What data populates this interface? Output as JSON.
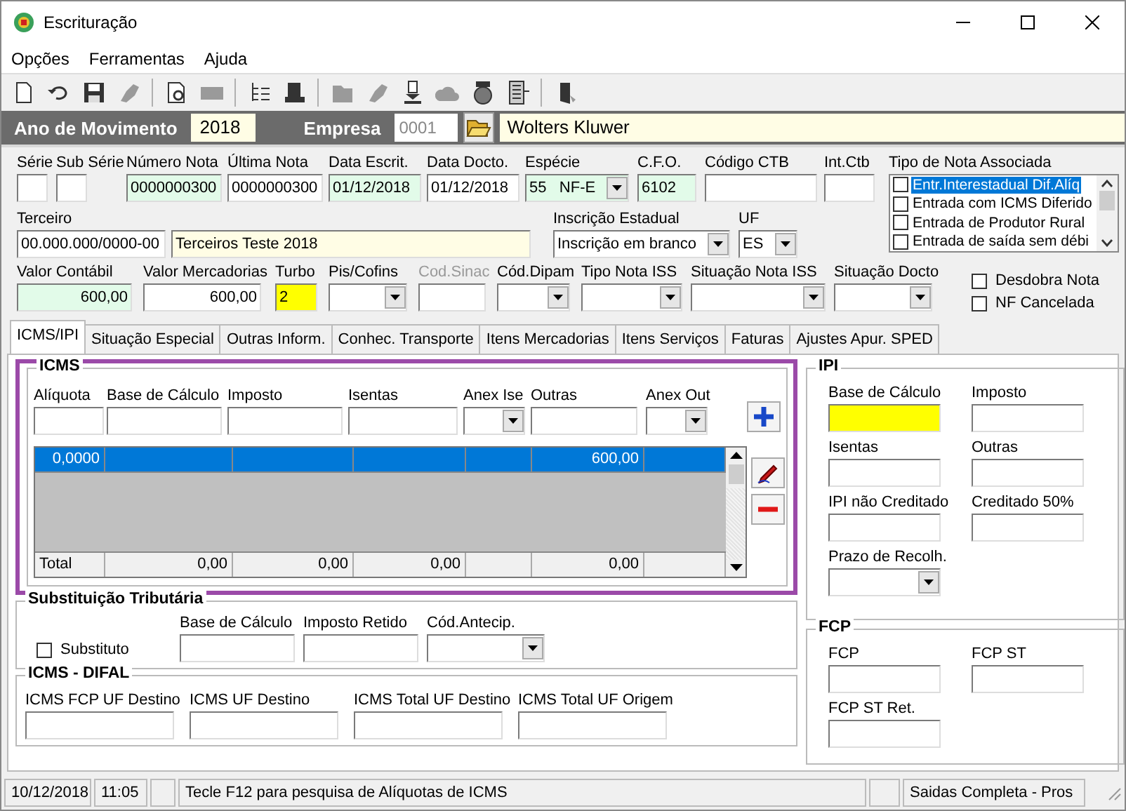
{
  "window": {
    "title": "Escrituração"
  },
  "menu": [
    {
      "label": "Opções"
    },
    {
      "label": "Ferramentas"
    },
    {
      "label": "Ajuda"
    }
  ],
  "toolbar": [
    {
      "kind": "page",
      "disabled": false
    },
    {
      "kind": "undo",
      "disabled": false
    },
    {
      "kind": "save",
      "disabled": false
    },
    {
      "kind": "brush",
      "disabled": true
    },
    {
      "kind": "sep"
    },
    {
      "kind": "preview",
      "disabled": false
    },
    {
      "kind": "nfe",
      "disabled": true
    },
    {
      "kind": "sep"
    },
    {
      "kind": "tree",
      "disabled": false
    },
    {
      "kind": "stamp",
      "disabled": false
    },
    {
      "kind": "sep"
    },
    {
      "kind": "folder",
      "disabled": true
    },
    {
      "kind": "brush",
      "disabled": true
    },
    {
      "kind": "download",
      "disabled": false
    },
    {
      "kind": "cloud",
      "disabled": true
    },
    {
      "kind": "coin",
      "disabled": false
    },
    {
      "kind": "list",
      "disabled": false
    },
    {
      "kind": "sep"
    },
    {
      "kind": "exit",
      "disabled": false
    }
  ],
  "header": {
    "year_label": "Ano de Movimento",
    "year": "2018",
    "company_label": "Empresa",
    "company_code": "0001",
    "company_name": "Wolters Kluwer"
  },
  "document_fields": [
    {
      "label": "Série",
      "kind": "text",
      "color": "#ffffff"
    },
    {
      "label": "Sub Série",
      "kind": "text",
      "color": "#ffffff"
    },
    {
      "label": "Número Nota",
      "value": "0000000300",
      "kind": "text",
      "color": "#e2fbe9"
    },
    {
      "label": "Última Nota",
      "value": "0000000300",
      "kind": "text",
      "color": "#ffffff"
    },
    {
      "label": "Data Escrit.",
      "value": "01/12/2018",
      "kind": "text",
      "color": "#e2fbe9"
    },
    {
      "label": "Data Docto.",
      "value": "01/12/2018",
      "kind": "text",
      "color": "#ffffff"
    },
    {
      "label": "Espécie",
      "value": "55   NF-E",
      "kind": "select",
      "color": "#e2fbe9"
    },
    {
      "label": "C.F.O.",
      "value": "6102",
      "kind": "text",
      "color": "#e2fbe9"
    },
    {
      "label": "Código CTB",
      "kind": "text",
      "color": "#ffffff"
    },
    {
      "label": "Int.Ctb",
      "kind": "text",
      "color": "#ffffff"
    }
  ],
  "party_fields": [
    {
      "label": "Terceiro",
      "value": "00.000.000/0000-00",
      "kind": "text",
      "color": "#ffffff"
    },
    {
      "value": "Terceiros Teste 2018",
      "kind": "text",
      "color": "#fffde5"
    },
    {
      "label": "Inscrição Estadual",
      "value": "Inscrição em branco",
      "kind": "select",
      "color": "#ffffff"
    },
    {
      "label": "UF",
      "value": "ES",
      "kind": "select",
      "color": "#ffffff"
    }
  ],
  "associated_types": {
    "label": "Tipo de Nota Associada",
    "items": [
      {
        "label": "Entr.Interestadual Dif.Alíq",
        "checked": false,
        "selected": true
      },
      {
        "label": "Entrada com ICMS Diferido",
        "checked": false,
        "selected": false
      },
      {
        "label": "Entrada de Produtor Rural",
        "checked": false,
        "selected": false
      },
      {
        "label": "Entrada de saída sem débi",
        "checked": false,
        "selected": false
      }
    ]
  },
  "value_fields": [
    {
      "label": "Valor Contábil",
      "value": "600,00",
      "kind": "number",
      "color": "#e2fbe9",
      "disabled": false
    },
    {
      "label": "Valor Mercadorias",
      "value": "600,00",
      "kind": "number",
      "color": "#ffffff",
      "disabled": false
    },
    {
      "label": "Turbo",
      "value": "2",
      "kind": "text",
      "color": "#ffff00",
      "disabled": false
    },
    {
      "label": "Pis/Cofins",
      "kind": "select",
      "color": "#ffffff",
      "disabled": false
    },
    {
      "label": "Cod.Sinac",
      "kind": "text",
      "color": "#ffffff",
      "disabled": true
    },
    {
      "label": "Cód.Dipam",
      "kind": "select",
      "color": "#ffffff",
      "disabled": false
    },
    {
      "label": "Tipo Nota ISS",
      "kind": "select",
      "color": "#ffffff",
      "disabled": false
    },
    {
      "label": "Situação Nota ISS",
      "kind": "select",
      "color": "#ffffff",
      "disabled": false
    },
    {
      "label": "Situação Docto",
      "kind": "select",
      "color": "#ffffff",
      "disabled": false
    }
  ],
  "flags": [
    {
      "label": "Desdobra Nota",
      "checked": false
    },
    {
      "label": "NF Cancelada",
      "checked": false
    }
  ],
  "tabs": [
    {
      "label": "ICMS/IPI",
      "selected": true
    },
    {
      "label": "Situação Especial",
      "selected": false
    },
    {
      "label": "Outras Inform.",
      "selected": false
    },
    {
      "label": "Conhec. Transporte",
      "selected": false
    },
    {
      "label": "Itens Mercadorias",
      "selected": false
    },
    {
      "label": "Itens Serviços",
      "selected": false
    },
    {
      "label": "Faturas",
      "selected": false
    },
    {
      "label": "Ajustes Apur. SPED",
      "selected": false
    }
  ],
  "icms": {
    "title": "ICMS",
    "fields": [
      {
        "label": "Alíquota",
        "kind": "text",
        "color": "#ffffff"
      },
      {
        "label": "Base de Cálculo",
        "kind": "text",
        "color": "#ffffff"
      },
      {
        "label": "Imposto",
        "kind": "text",
        "color": "#ffffff"
      },
      {
        "label": "Isentas",
        "kind": "text",
        "color": "#ffffff"
      },
      {
        "label": "Anex Ise",
        "kind": "select",
        "color": "#ffffff"
      },
      {
        "label": "Outras",
        "kind": "text",
        "color": "#ffffff"
      },
      {
        "label": "Anex Out",
        "kind": "select",
        "color": "#ffffff"
      }
    ],
    "grid": {
      "rows": [
        {
          "selected": true,
          "cells": [
            {
              "kind": "value",
              "text": "0,0000"
            },
            {
              "kind": "blank"
            },
            {
              "kind": "blank"
            },
            {
              "kind": "blank"
            },
            {
              "kind": "blank"
            },
            {
              "kind": "value",
              "text": "600,00"
            },
            {
              "kind": "blank"
            }
          ]
        }
      ],
      "totals": [
        {
          "kind": "label",
          "text": "Total"
        },
        {
          "kind": "value",
          "text": "0,00"
        },
        {
          "kind": "value",
          "text": "0,00"
        },
        {
          "kind": "value",
          "text": "0,00"
        },
        {
          "kind": "blank"
        },
        {
          "kind": "value",
          "text": "0,00"
        },
        {
          "kind": "blank"
        }
      ]
    }
  },
  "ipi": {
    "title": "IPI",
    "fields": [
      {
        "label": "Base de Cálculo",
        "kind": "text",
        "color": "#ffff00"
      },
      {
        "label": "Imposto",
        "kind": "text",
        "color": "#ffffff"
      },
      {
        "label": "Isentas",
        "kind": "text",
        "color": "#ffffff"
      },
      {
        "label": "Outras",
        "kind": "text",
        "color": "#ffffff"
      },
      {
        "label": "IPI não Creditado",
        "kind": "text",
        "color": "#ffffff"
      },
      {
        "label": "Creditado 50%",
        "kind": "text",
        "color": "#ffffff"
      },
      {
        "label": "Prazo de Recolh.",
        "kind": "select",
        "color": "#ffffff"
      }
    ]
  },
  "substitution": {
    "title": "Substituição Tributária",
    "substitute": {
      "label": "Substituto",
      "checked": false
    },
    "fields": [
      {
        "label": "Base de Cálculo",
        "kind": "text",
        "color": "#ffffff"
      },
      {
        "label": "Imposto Retido",
        "kind": "text",
        "color": "#ffffff"
      },
      {
        "label": "Cód.Antecip.",
        "kind": "select",
        "color": "#ffffff"
      }
    ]
  },
  "difal": {
    "title": "ICMS - DIFAL",
    "fields": [
      {
        "label": "ICMS FCP UF Destino",
        "kind": "text",
        "color": "#ffffff"
      },
      {
        "label": "ICMS UF Destino",
        "kind": "text",
        "color": "#ffffff"
      },
      {
        "label": "ICMS Total UF Destino",
        "kind": "text",
        "color": "#ffffff"
      },
      {
        "label": "ICMS Total UF Origem",
        "kind": "text",
        "color": "#ffffff"
      }
    ]
  },
  "fcp": {
    "title": "FCP",
    "fields": [
      {
        "label": "FCP",
        "kind": "text",
        "color": "#ffffff"
      },
      {
        "label": "FCP ST",
        "kind": "text",
        "color": "#ffffff"
      },
      {
        "label": "FCP ST Ret.",
        "kind": "text",
        "color": "#ffffff"
      }
    ]
  },
  "status_bar": [
    {
      "kind": "text",
      "text": "10/12/2018"
    },
    {
      "kind": "text",
      "text": "11:05"
    },
    {
      "kind": "blank"
    },
    {
      "kind": "text",
      "text": "Tecle F12 para pesquisa de Alíquotas de ICMS"
    },
    {
      "kind": "blank"
    },
    {
      "kind": "text",
      "text": "Saidas Completa - Pros"
    }
  ]
}
